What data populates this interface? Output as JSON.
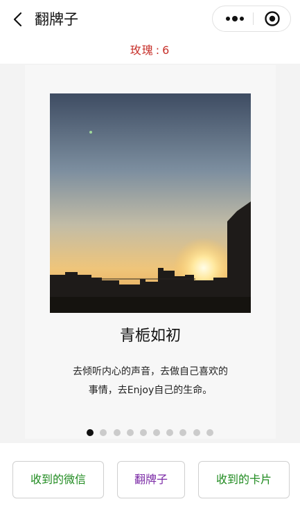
{
  "navbar": {
    "title": "翻牌子",
    "back_icon": "chevron-left-icon",
    "more_icon": "more-dots-icon",
    "close_icon": "target-close-icon"
  },
  "roses": {
    "label": "玫瑰",
    "separator": ":",
    "count": "6"
  },
  "card": {
    "title": "青栀如初",
    "text_line1": "去倾听内心的声音，去做自己喜欢的",
    "text_line2": "事情，去Enjoy自己的生命。"
  },
  "pagination": {
    "total": 10,
    "active": 1
  },
  "buttons": {
    "received_wechat": "收到的微信",
    "flip": "翻牌子",
    "received_cards": "收到的卡片"
  },
  "colors": {
    "rose_count": "#c7312b",
    "button_green": "#1e8a1e",
    "button_purple": "#7b2aa6"
  }
}
